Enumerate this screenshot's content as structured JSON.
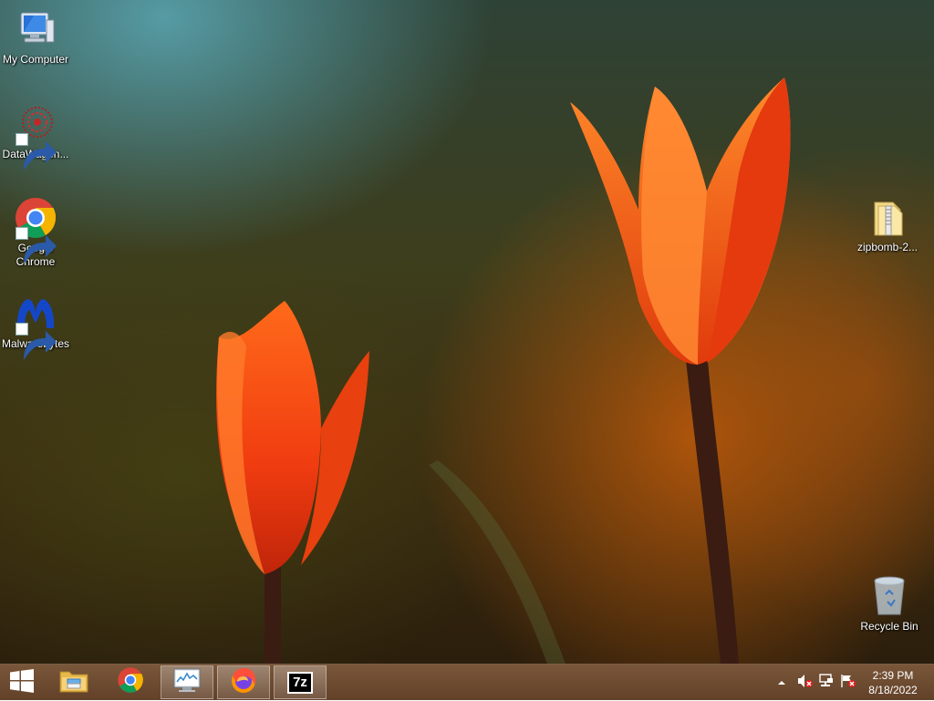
{
  "desktop": {
    "icons": [
      {
        "label": "My Computer",
        "icon": "computer-icon"
      },
      {
        "label": "DataWagon...",
        "icon": "datawagon-icon",
        "shortcut": true
      },
      {
        "label": "Google Chrome",
        "icon": "chrome-icon",
        "shortcut": true
      },
      {
        "label": "Malwarebytes",
        "icon": "malwarebytes-icon",
        "shortcut": true
      },
      {
        "label": "zipbomb-2...",
        "icon": "folder-icon"
      },
      {
        "label": "Recycle Bin",
        "icon": "recycle-bin-icon"
      }
    ]
  },
  "taskbar": {
    "start": {
      "icon": "windows-logo-icon"
    },
    "apps": [
      {
        "name": "File Explorer",
        "icon": "file-explorer-icon",
        "active": false
      },
      {
        "name": "Google Chrome",
        "icon": "chrome-icon",
        "active": false
      },
      {
        "name": "Task Manager",
        "icon": "task-manager-icon",
        "active": true
      },
      {
        "name": "Firefox",
        "icon": "firefox-icon",
        "active": true
      },
      {
        "name": "7-Zip",
        "icon": "7zip-icon",
        "active": true,
        "text": "7z"
      }
    ],
    "tray": {
      "icons": [
        "show-hidden-icons-chevron-icon",
        "volume-muted-icon",
        "network-icon",
        "action-center-alert-icon"
      ]
    },
    "clock": {
      "time": "2:39 PM",
      "date": "8/18/2022"
    }
  },
  "colors": {
    "taskbar": "#6e4828",
    "tulip": "#f24a12"
  }
}
